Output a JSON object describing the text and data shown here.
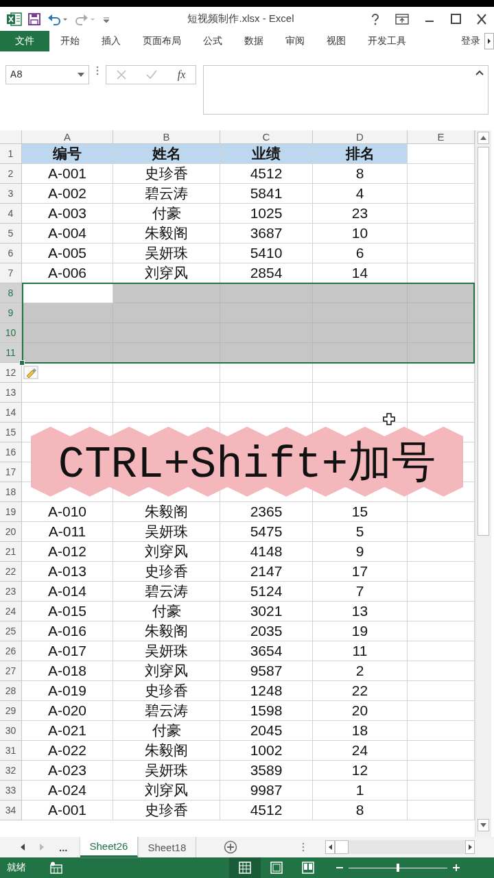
{
  "window": {
    "title": "短视频制作.xlsx - Excel"
  },
  "ribbon_tabs": [
    {
      "label": "文件",
      "kind": "file"
    },
    {
      "label": "开始",
      "kind": "tab"
    },
    {
      "label": "插入",
      "kind": "tab"
    },
    {
      "label": "页面布局",
      "kind": "tab"
    },
    {
      "label": "公式",
      "kind": "tab"
    },
    {
      "label": "数据",
      "kind": "tab"
    },
    {
      "label": "审阅",
      "kind": "tab"
    },
    {
      "label": "视图",
      "kind": "tab"
    },
    {
      "label": "开发工具",
      "kind": "tab"
    },
    {
      "label": "登录",
      "kind": "signin"
    }
  ],
  "formula_bar": {
    "name_box": "A8",
    "fx_label": "fx"
  },
  "sheet": {
    "columns": [
      "A",
      "B",
      "C",
      "D",
      "E"
    ],
    "rows": [
      {
        "number": "1",
        "kind": "header",
        "selected": false,
        "cells": [
          "编号",
          "姓名",
          "业绩",
          "排名"
        ]
      },
      {
        "number": "2",
        "kind": "data",
        "selected": false,
        "cells": [
          "A-001",
          "史珍香",
          "4512",
          "8"
        ]
      },
      {
        "number": "3",
        "kind": "data",
        "selected": false,
        "cells": [
          "A-002",
          "碧云涛",
          "5841",
          "4"
        ]
      },
      {
        "number": "4",
        "kind": "data",
        "selected": false,
        "cells": [
          "A-003",
          "付豪",
          "1025",
          "23"
        ]
      },
      {
        "number": "5",
        "kind": "data",
        "selected": false,
        "cells": [
          "A-004",
          "朱毅阁",
          "3687",
          "10"
        ]
      },
      {
        "number": "6",
        "kind": "data",
        "selected": false,
        "cells": [
          "A-005",
          "吴妍珠",
          "5410",
          "6"
        ]
      },
      {
        "number": "7",
        "kind": "data",
        "selected": false,
        "cells": [
          "A-006",
          "刘穿风",
          "2854",
          "14"
        ]
      },
      {
        "number": "8",
        "kind": "data",
        "selected": true,
        "cells": []
      },
      {
        "number": "9",
        "kind": "data",
        "selected": true,
        "cells": []
      },
      {
        "number": "10",
        "kind": "data",
        "selected": true,
        "cells": []
      },
      {
        "number": "11",
        "kind": "data",
        "selected": true,
        "cells": []
      },
      {
        "number": "12",
        "kind": "data",
        "selected": false,
        "cells": []
      },
      {
        "number": "13",
        "kind": "data",
        "selected": false,
        "cells": []
      },
      {
        "number": "14",
        "kind": "data",
        "selected": false,
        "cells": []
      },
      {
        "number": "15",
        "kind": "data",
        "selected": false,
        "cells": []
      },
      {
        "number": "16",
        "kind": "data",
        "selected": false,
        "cells": []
      },
      {
        "number": "17",
        "kind": "data",
        "selected": false,
        "cells": []
      },
      {
        "number": "18",
        "kind": "data",
        "selected": false,
        "cells": []
      },
      {
        "number": "19",
        "kind": "data",
        "selected": false,
        "cells": [
          "A-010",
          "朱毅阁",
          "2365",
          "15"
        ]
      },
      {
        "number": "20",
        "kind": "data",
        "selected": false,
        "cells": [
          "A-011",
          "吴妍珠",
          "5475",
          "5"
        ]
      },
      {
        "number": "21",
        "kind": "data",
        "selected": false,
        "cells": [
          "A-012",
          "刘穿风",
          "4148",
          "9"
        ]
      },
      {
        "number": "22",
        "kind": "data",
        "selected": false,
        "cells": [
          "A-013",
          "史珍香",
          "2147",
          "17"
        ]
      },
      {
        "number": "23",
        "kind": "data",
        "selected": false,
        "cells": [
          "A-014",
          "碧云涛",
          "5124",
          "7"
        ]
      },
      {
        "number": "24",
        "kind": "data",
        "selected": false,
        "cells": [
          "A-015",
          "付豪",
          "3021",
          "13"
        ]
      },
      {
        "number": "25",
        "kind": "data",
        "selected": false,
        "cells": [
          "A-016",
          "朱毅阁",
          "2035",
          "19"
        ]
      },
      {
        "number": "26",
        "kind": "data",
        "selected": false,
        "cells": [
          "A-017",
          "吴妍珠",
          "3654",
          "11"
        ]
      },
      {
        "number": "27",
        "kind": "data",
        "selected": false,
        "cells": [
          "A-018",
          "刘穿风",
          "9587",
          "2"
        ]
      },
      {
        "number": "28",
        "kind": "data",
        "selected": false,
        "cells": [
          "A-019",
          "史珍香",
          "1248",
          "22"
        ]
      },
      {
        "number": "29",
        "kind": "data",
        "selected": false,
        "cells": [
          "A-020",
          "碧云涛",
          "1598",
          "20"
        ]
      },
      {
        "number": "30",
        "kind": "data",
        "selected": false,
        "cells": [
          "A-021",
          "付豪",
          "2045",
          "18"
        ]
      },
      {
        "number": "31",
        "kind": "data",
        "selected": false,
        "cells": [
          "A-022",
          "朱毅阁",
          "1002",
          "24"
        ]
      },
      {
        "number": "32",
        "kind": "data",
        "selected": false,
        "cells": [
          "A-023",
          "吴妍珠",
          "3589",
          "12"
        ]
      },
      {
        "number": "33",
        "kind": "data",
        "selected": false,
        "cells": [
          "A-024",
          "刘穿风",
          "9987",
          "1"
        ]
      },
      {
        "number": "34",
        "kind": "data",
        "selected": false,
        "cells": [
          "A-001",
          "史珍香",
          "4512",
          "8"
        ]
      }
    ]
  },
  "overlay_caption": "CTRL+Shift+加号",
  "sheet_tabs": {
    "overflow": "...",
    "tabs": [
      {
        "label": "Sheet26",
        "selected": true
      },
      {
        "label": "Sheet18",
        "selected": false
      }
    ]
  },
  "status_bar": {
    "status": "就绪",
    "zoom": {
      "level": 0.5
    },
    "views": [
      {
        "kind": "normal",
        "selected": true
      },
      {
        "kind": "page_layout",
        "selected": false
      },
      {
        "kind": "page_break",
        "selected": false
      }
    ]
  }
}
